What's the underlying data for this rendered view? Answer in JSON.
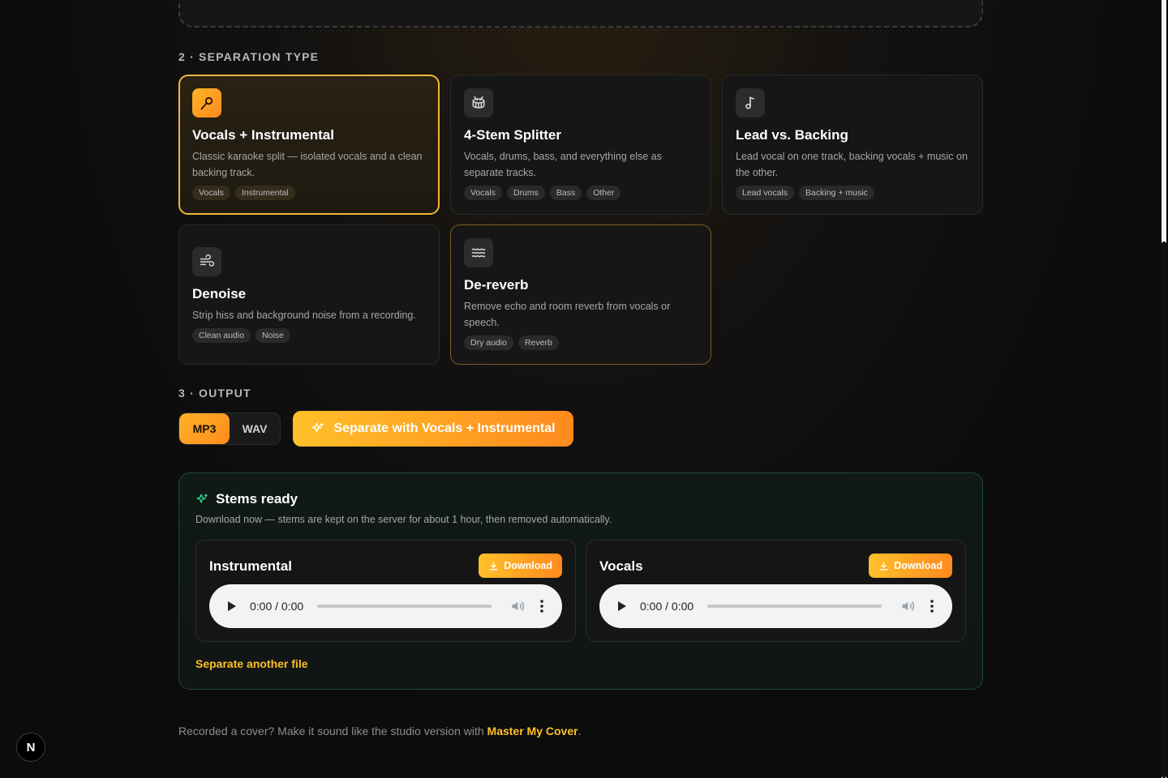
{
  "sections": {
    "separation_title": "2 · SEPARATION TYPE",
    "output_title": "3 · OUTPUT"
  },
  "cards": [
    {
      "title": "Vocals + Instrumental",
      "desc": "Classic karaoke split — isolated vocals and a clean backing track.",
      "tags": [
        "Vocals",
        "Instrumental"
      ],
      "icon": "microphone-icon",
      "selected": true
    },
    {
      "title": "4-Stem Splitter",
      "desc": "Vocals, drums, bass, and everything else as separate tracks.",
      "tags": [
        "Vocals",
        "Drums",
        "Bass",
        "Other"
      ],
      "icon": "drum-icon"
    },
    {
      "title": "Lead vs. Backing",
      "desc": "Lead vocal on one track, backing vocals + music on the other.",
      "tags": [
        "Lead vocals",
        "Backing + music"
      ],
      "icon": "music-note-icon"
    },
    {
      "title": "Denoise",
      "desc": "Strip hiss and background noise from a recording.",
      "tags": [
        "Clean audio",
        "Noise"
      ],
      "icon": "wind-icon"
    },
    {
      "title": "De-reverb",
      "desc": "Remove echo and room reverb from vocals or speech.",
      "tags": [
        "Dry audio",
        "Reverb"
      ],
      "icon": "waves-icon"
    }
  ],
  "output": {
    "formats": [
      "MP3",
      "WAV"
    ],
    "selected_format": "MP3",
    "action_label": "Separate with Vocals + Instrumental"
  },
  "results": {
    "title": "Stems ready",
    "subtitle": "Download now — stems are kept on the server for about 1 hour, then removed automatically.",
    "stems": [
      {
        "name": "Instrumental",
        "download_label": "Download",
        "time": "0:00 / 0:00"
      },
      {
        "name": "Vocals",
        "download_label": "Download",
        "time": "0:00 / 0:00"
      }
    ],
    "again_label": "Separate another file"
  },
  "footer": {
    "text": "Recorded a cover? Make it sound like the studio version with ",
    "link": "Master My Cover",
    "end": "."
  },
  "badge": "N",
  "colors": {
    "accent": "#ffb326",
    "accent2": "#ff8a1e",
    "success": "#2fd08a"
  }
}
